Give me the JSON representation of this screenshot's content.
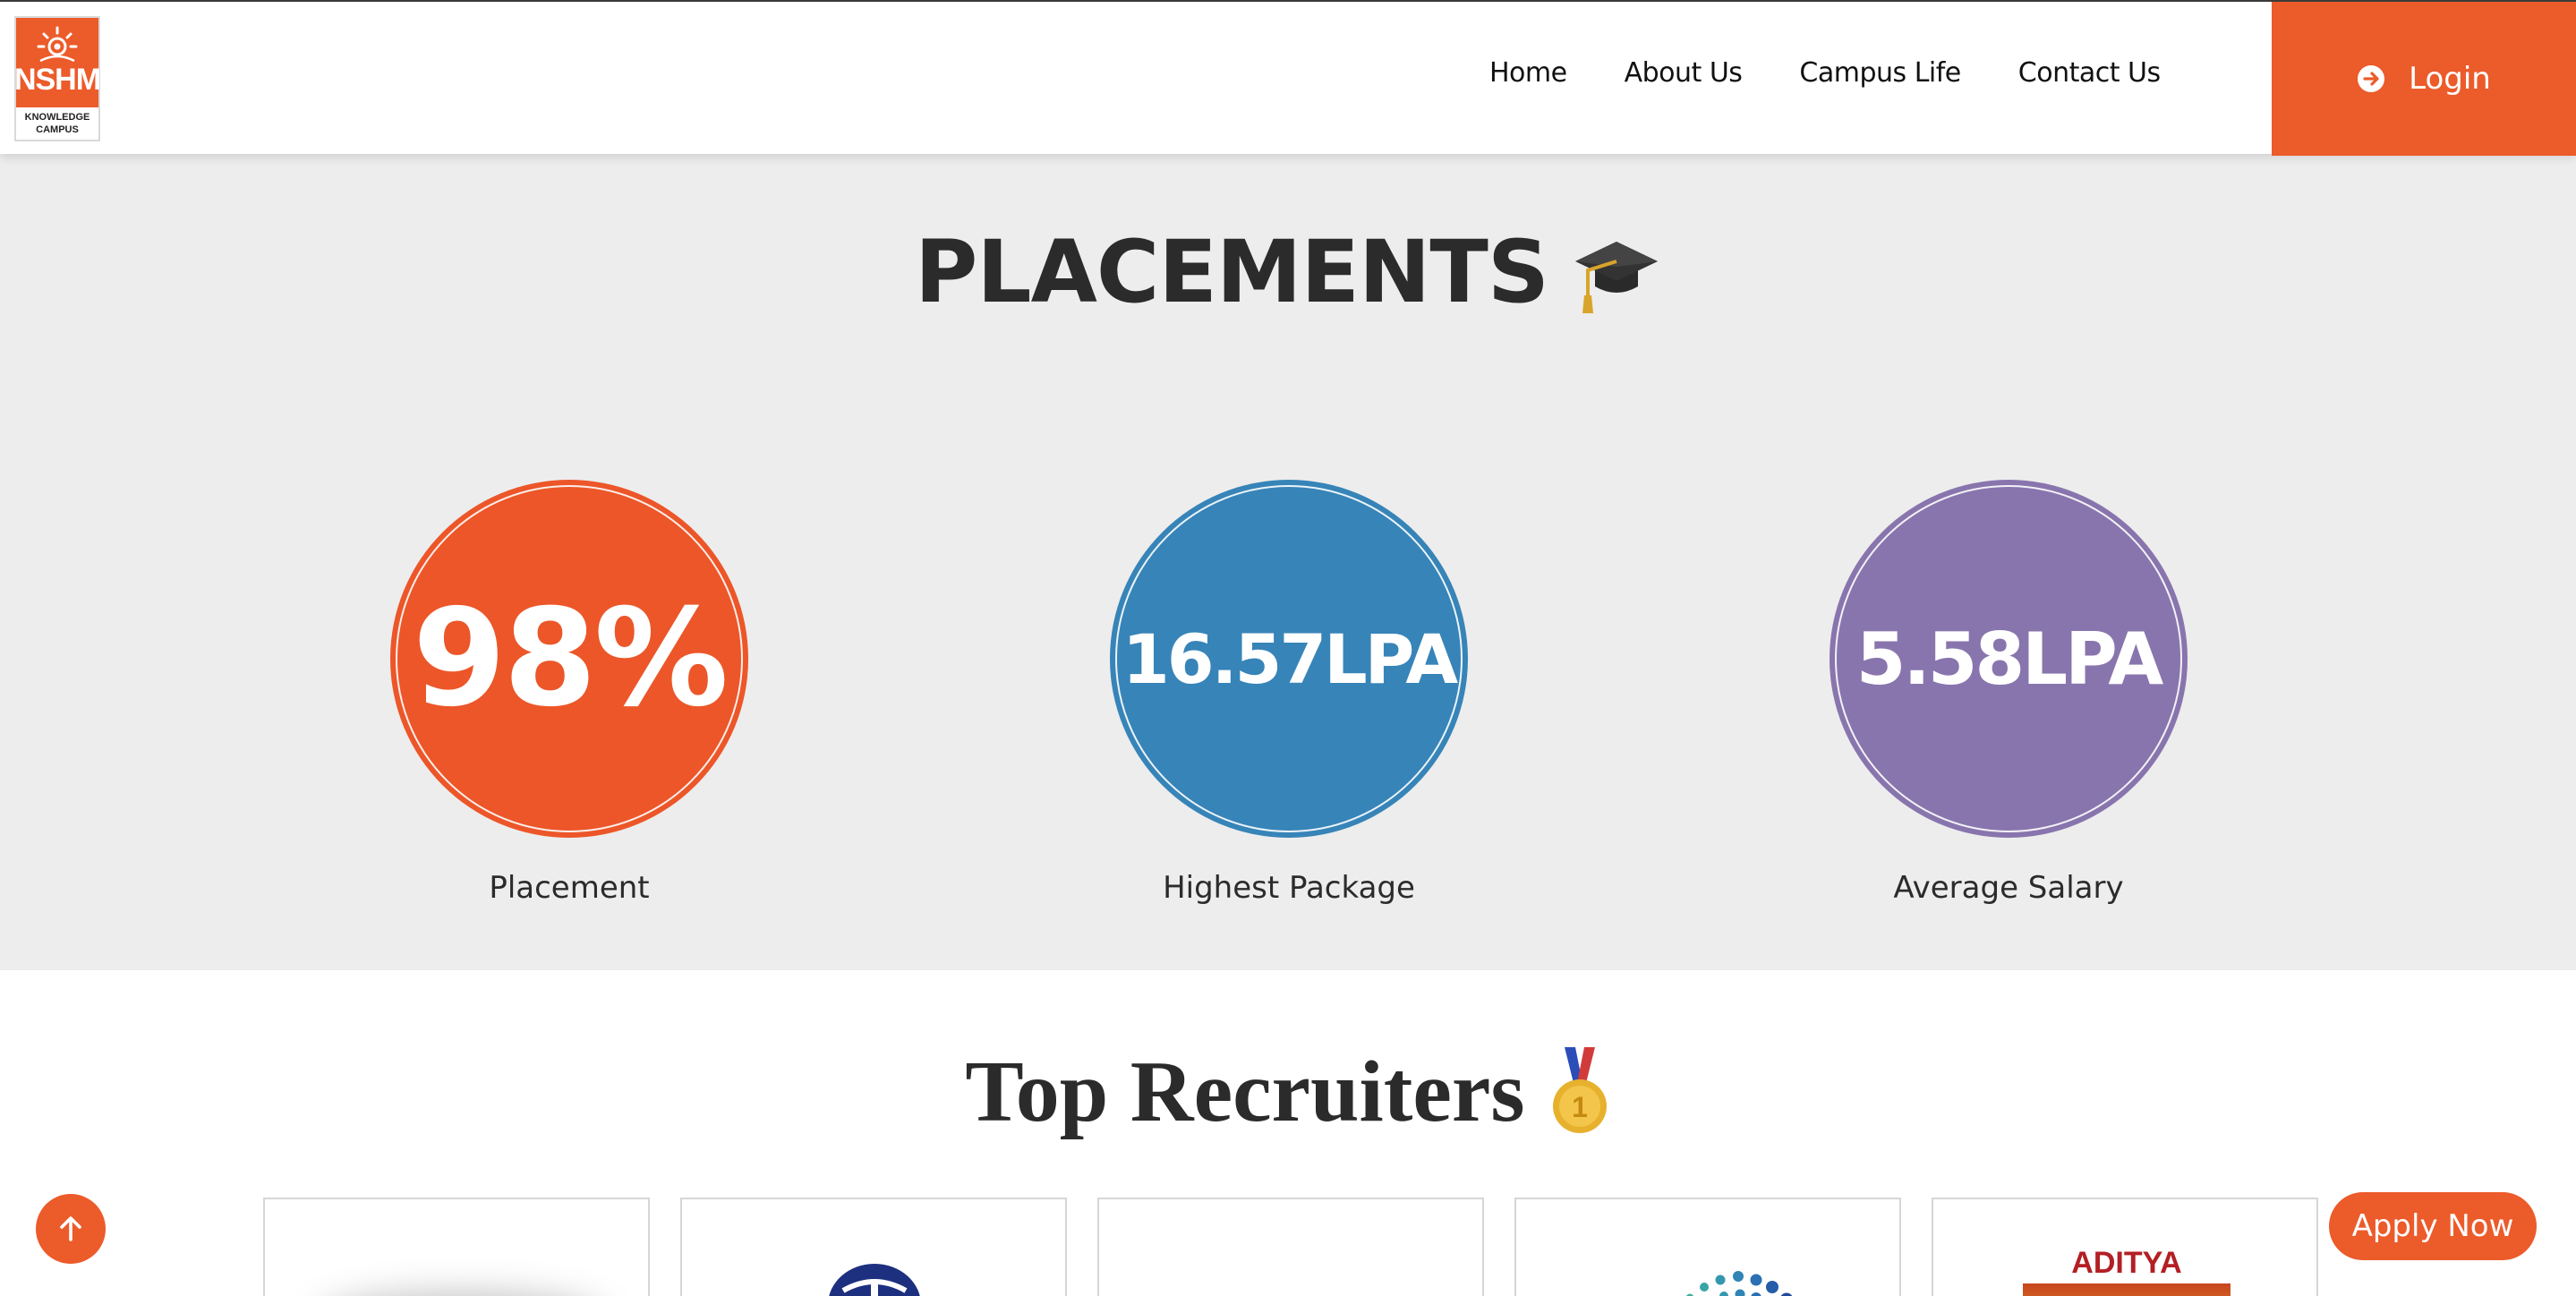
{
  "header": {
    "logo": {
      "brand": "NSHM",
      "sub": "KNOWLEDGE CAMPUS"
    },
    "nav": [
      {
        "label": "Home"
      },
      {
        "label": "About Us"
      },
      {
        "label": "Campus Life"
      },
      {
        "label": "Contact Us"
      }
    ],
    "login_label": "Login"
  },
  "placements": {
    "title": "PLACEMENTS",
    "title_icon": "graduation-cap-icon",
    "stats": [
      {
        "value": "98%",
        "label": "Placement",
        "color": "#ec5629"
      },
      {
        "value": "16.57LPA",
        "label": "Highest Package",
        "color": "#3784b8"
      },
      {
        "value": "5.58LPA",
        "label": "Average Salary",
        "color": "#8875ad"
      }
    ]
  },
  "recruiters": {
    "title": "Top Recruiters",
    "title_icon": "first-place-medal-icon",
    "cards": [
      {
        "logo": ""
      },
      {
        "logo": "tata-logo"
      },
      {
        "logo": ""
      },
      {
        "logo": "dotted-arc-logo"
      },
      {
        "logo": "ADITYA BIRLA"
      }
    ]
  },
  "buttons": {
    "scroll_top_icon": "arrow-up-icon",
    "apply_now": "Apply Now"
  },
  "colors": {
    "accent": "#ec5b2a",
    "section_bg": "#ededed"
  }
}
